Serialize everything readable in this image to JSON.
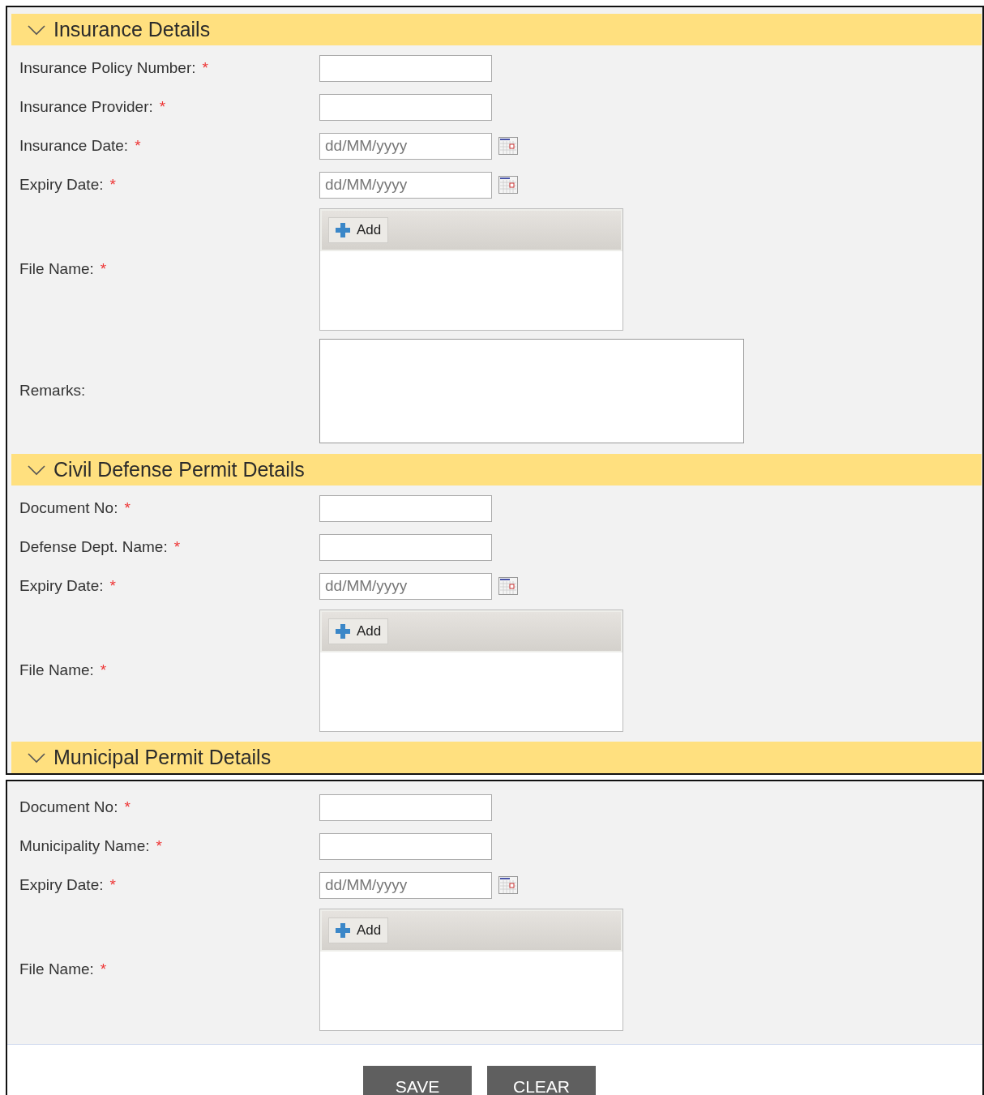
{
  "panels": [
    {
      "sections": [
        {
          "title": "Insurance Details",
          "expanded": true,
          "fields": [
            {
              "kind": "text",
              "label": "Insurance Policy Number:",
              "marker": "*"
            },
            {
              "kind": "text",
              "label": "Insurance Provider:",
              "marker": "*"
            },
            {
              "kind": "date",
              "label": "Insurance Date:",
              "marker": "*",
              "placeholder": "dd/MM/yyyy"
            },
            {
              "kind": "date",
              "label": "Expiry Date:",
              "marker": "*",
              "placeholder": "dd/MM/yyyy"
            },
            {
              "kind": "upload",
              "label": "File Name:",
              "marker": "*",
              "button": "Add"
            },
            {
              "kind": "textarea",
              "label": "Remarks:"
            }
          ]
        },
        {
          "title": "Civil Defense Permit Details",
          "expanded": true,
          "fields": [
            {
              "kind": "text",
              "label": "Document No:",
              "marker": "*"
            },
            {
              "kind": "text",
              "label": "Defense Dept. Name:",
              "marker": "*"
            },
            {
              "kind": "date",
              "label": "Expiry Date:",
              "marker": "*",
              "placeholder": "dd/MM/yyyy"
            },
            {
              "kind": "upload",
              "label": "File Name:",
              "marker": "*",
              "button": "Add"
            }
          ]
        },
        {
          "title": "Municipal Permit Details",
          "expanded": true
        }
      ]
    },
    {
      "sections": [
        {
          "fields": [
            {
              "kind": "text",
              "label": "Document No:",
              "marker": "*"
            },
            {
              "kind": "text",
              "label": "Municipality Name:",
              "marker": "*"
            },
            {
              "kind": "date",
              "label": "Expiry Date:",
              "marker": "*",
              "placeholder": "dd/MM/yyyy"
            },
            {
              "kind": "upload",
              "label": "File Name:",
              "marker": "*",
              "button": "Add"
            }
          ]
        }
      ],
      "buttons": [
        "SAVE",
        "CLEAR"
      ]
    }
  ]
}
